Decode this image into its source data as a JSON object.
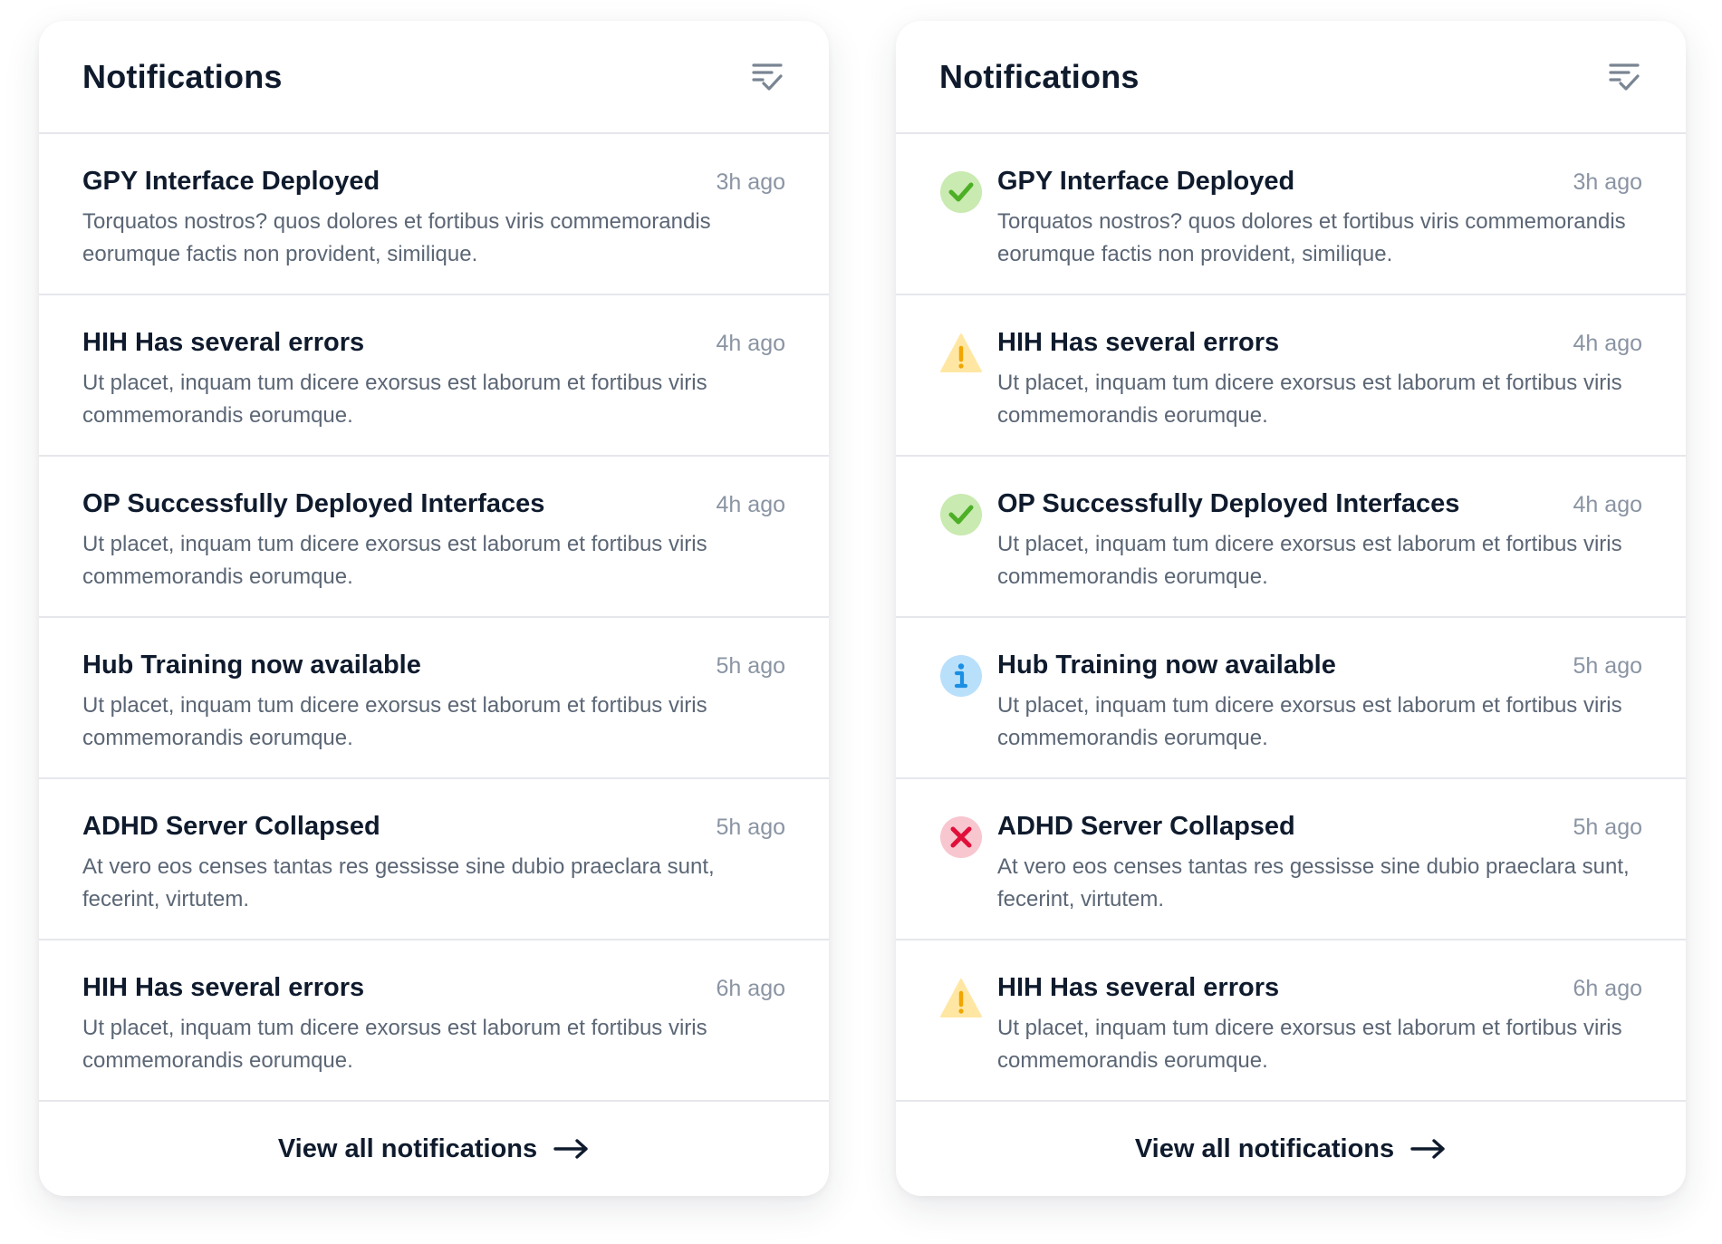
{
  "panels": [
    {
      "title": "Notifications",
      "footer_label": "View all notifications",
      "items": [
        {
          "title": "GPY Interface Deployed",
          "time": "3h ago",
          "body": "Torquatos nostros? quos dolores et fortibus viris commemorandis eorumque factis non provident, similique."
        },
        {
          "title": "HIH Has several errors",
          "time": "4h ago",
          "body": "Ut placet, inquam tum dicere exorsus est laborum et fortibus viris commemorandis eorumque."
        },
        {
          "title": "OP Successfully Deployed Interfaces",
          "time": "4h ago",
          "body": "Ut placet, inquam tum dicere exorsus est laborum et fortibus viris commemorandis eorumque."
        },
        {
          "title": "Hub Training now available",
          "time": "5h ago",
          "body": "Ut placet, inquam tum dicere exorsus est laborum et fortibus viris commemorandis eorumque."
        },
        {
          "title": "ADHD Server Collapsed",
          "time": "5h ago",
          "body": "At vero eos censes tantas res gessisse sine dubio praeclara sunt, fecerint, virtutem."
        },
        {
          "title": "HIH Has several errors",
          "time": "6h ago",
          "body": "Ut placet, inquam tum dicere exorsus est laborum et fortibus viris commemorandis eorumque."
        }
      ]
    },
    {
      "title": "Notifications",
      "footer_label": "View all notifications",
      "items": [
        {
          "status": "success",
          "icon": "check-circle-icon",
          "title": "GPY Interface Deployed",
          "time": "3h ago",
          "body": "Torquatos nostros? quos dolores et fortibus viris commemorandis eorumque factis non provident, similique."
        },
        {
          "status": "warning",
          "icon": "warning-triangle-icon",
          "title": "HIH Has several errors",
          "time": "4h ago",
          "body": "Ut placet, inquam tum dicere exorsus est laborum et fortibus viris commemorandis eorumque."
        },
        {
          "status": "success",
          "icon": "check-circle-icon",
          "title": "OP Successfully Deployed Interfaces",
          "time": "4h ago",
          "body": "Ut placet, inquam tum dicere exorsus est laborum et fortibus viris commemorandis eorumque."
        },
        {
          "status": "info",
          "icon": "info-circle-icon",
          "title": "Hub Training now available",
          "time": "5h ago",
          "body": "Ut placet, inquam tum dicere exorsus est laborum et fortibus viris commemorandis eorumque."
        },
        {
          "status": "error",
          "icon": "error-circle-icon",
          "title": "ADHD Server Collapsed",
          "time": "5h ago",
          "body": "At vero eos censes tantas res gessisse sine dubio praeclara sunt, fecerint, virtutem."
        },
        {
          "status": "warning",
          "icon": "warning-triangle-icon",
          "title": "HIH Has several errors",
          "time": "6h ago",
          "body": "Ut placet, inquam tum dicere exorsus est laborum et fortibus viris commemorandis eorumque."
        }
      ]
    }
  ],
  "icons": {
    "header": "mark-all-read-icon",
    "footer": "arrow-right-icon"
  },
  "colors": {
    "success_bg": "#c9eab0",
    "success_fg": "#4caf25",
    "warning_bg": "#ffe7a3",
    "warning_fg": "#f0a500",
    "info_bg": "#b9e0fb",
    "info_fg": "#1a8fe3",
    "error_bg": "#f8c6cf",
    "error_fg": "#e0103a"
  }
}
